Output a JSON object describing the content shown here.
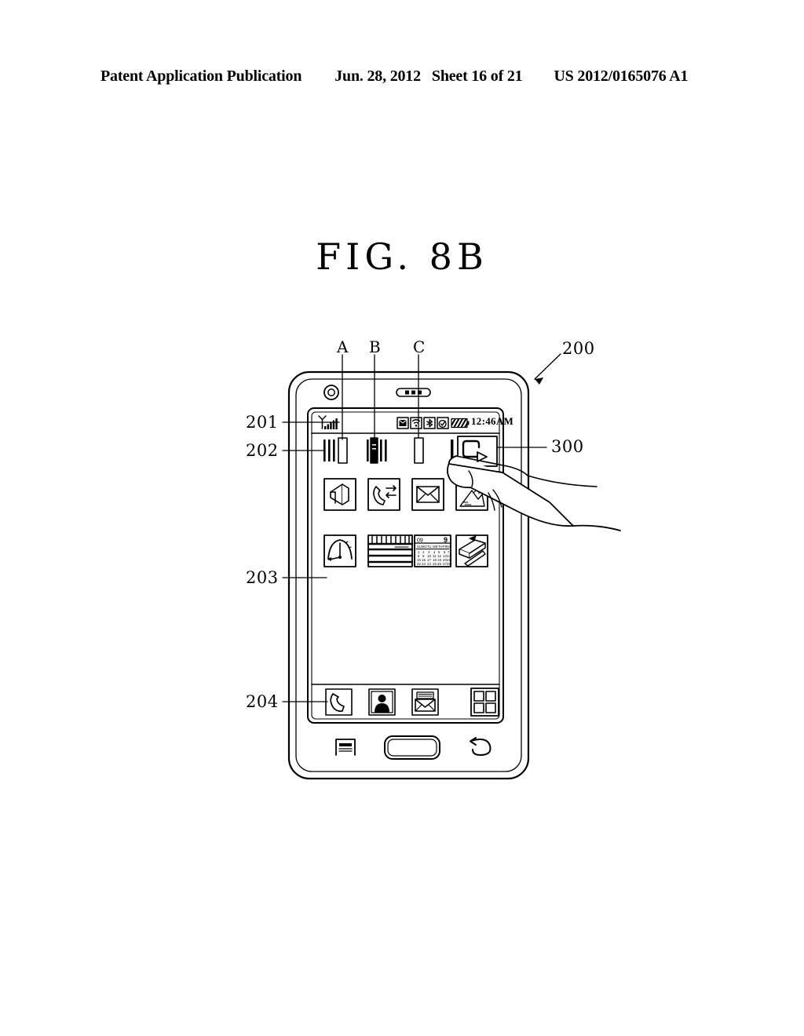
{
  "header": {
    "publication": "Patent Application Publication",
    "date": "Jun. 28, 2012",
    "sheet": "Sheet 16 of 21",
    "number": "US 2012/0165076 A1"
  },
  "figure": {
    "title": "FIG.  8B"
  },
  "callouts": {
    "device": "200",
    "status_bar": "201",
    "indicator_row": "202",
    "app_grid": "203",
    "dock": "204",
    "touch_hand": "300",
    "letter_a": "A",
    "letter_b": "B",
    "letter_c": "C"
  },
  "device": {
    "hardware": {
      "camera": "camera-lens",
      "earpiece": "earpiece-speaker",
      "menu_button": "menu-button",
      "home_button": "home-button",
      "back_button": "back-button"
    },
    "status_bar": {
      "signal_icon": "signal-bars-icon",
      "icons": [
        {
          "name": "message-icon"
        },
        {
          "name": "wifi-icon"
        },
        {
          "name": "bluetooth-icon"
        },
        {
          "name": "alarm-icon"
        }
      ],
      "battery_icon": "battery-icon",
      "time": "12:46AM"
    },
    "indicator_row": {
      "groups": [
        {
          "name": "indicator-group-a",
          "label": "A"
        },
        {
          "name": "indicator-group-b",
          "label": "B"
        },
        {
          "name": "indicator-group-c",
          "label": "C"
        },
        {
          "name": "indicator-group-selected",
          "label": ""
        }
      ]
    },
    "app_grid": {
      "rows": [
        [
          {
            "name": "app-icon-broadcast"
          },
          {
            "name": "app-icon-call"
          },
          {
            "name": "app-icon-message"
          },
          {
            "name": "app-icon-gallery"
          }
        ],
        [
          {
            "name": "app-icon-clock"
          },
          {
            "name": "app-icon-memo"
          },
          {
            "name": "app-icon-calendar"
          },
          {
            "name": "app-icon-notebook"
          }
        ]
      ],
      "calendar": {
        "month": "09",
        "day": "9",
        "weekdays": [
          "SU",
          "MO",
          "TU",
          "WE",
          "TH",
          "FR",
          "SA"
        ],
        "weeks": [
          [
            "1",
            "2",
            "3",
            "4",
            "5",
            "6",
            "7"
          ],
          [
            "8",
            "9",
            "10",
            "11",
            "12",
            "13",
            "14"
          ],
          [
            "15",
            "16",
            "17",
            "18",
            "19",
            "20",
            "21"
          ],
          [
            "22",
            "23",
            "24",
            "25",
            "26",
            "27",
            "28"
          ]
        ]
      }
    },
    "dock": {
      "items": [
        {
          "name": "dock-icon-phone"
        },
        {
          "name": "dock-icon-contacts"
        },
        {
          "name": "dock-icon-mail"
        },
        {
          "name": "dock-icon-apps"
        }
      ]
    }
  }
}
